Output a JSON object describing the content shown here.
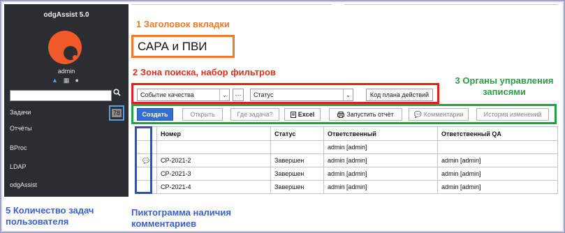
{
  "sidebar": {
    "app_title": "odgAssist 5.0",
    "user": "admin",
    "icons": [
      "warning-icon",
      "grid-icon",
      "user-icon"
    ],
    "search_icon": "🔍",
    "items": [
      {
        "label": "Задачи",
        "badge": "78"
      },
      {
        "label": "Отчёты"
      },
      {
        "label": "BProc"
      },
      {
        "label": "LDAP"
      },
      {
        "label": "odgAssist"
      }
    ]
  },
  "annotations": {
    "a1": "1 Заголовок вкладки",
    "a2": "2 Зона поиска, набор фильтров",
    "a3_line1": "3 Органы управления",
    "a3_line2": "записями",
    "a5_line1": "5 Количество задач",
    "a5_line2": "пользователя",
    "a_icon_line1": "Пиктограмма наличия",
    "a_icon_line2": "комментариев"
  },
  "page_title": "САРА и ПВИ",
  "filters": {
    "type_select": "Событие качества",
    "dots": "···",
    "status_select": "Статус",
    "plan_button": "Код плана действий"
  },
  "toolbar": {
    "create": "Создать",
    "open": "Открыть",
    "where_task": "Где задача?",
    "excel": "Excel",
    "run_report": "Запустить отчёт",
    "comments": "Комментарии",
    "history": "История изменений"
  },
  "table": {
    "headers": [
      "",
      "Номер",
      "Статус",
      "Ответственный",
      "Ответственный QA"
    ],
    "rows": [
      {
        "comment": false,
        "number": "",
        "status": "",
        "responsible": "admin [admin]",
        "qa": ""
      },
      {
        "comment": true,
        "number": "CP-2021-2",
        "status": "Завершен",
        "responsible": "admin [admin]",
        "qa": "admin [admin]"
      },
      {
        "comment": false,
        "number": "CP-2021-3",
        "status": "Завершен",
        "responsible": "admin [admin]",
        "qa": "admin [admin]"
      },
      {
        "comment": false,
        "number": "CP-2021-4",
        "status": "Завершен",
        "responsible": "admin [admin]",
        "qa": "admin [admin]"
      }
    ]
  },
  "colors": {
    "annotation_1": "#f07a2c",
    "annotation_2": "#e0301e",
    "annotation_3": "#2aa043",
    "annotation_blue": "#3a5fd0",
    "sidebar_bg": "#2b2d32",
    "logo": "#f05a28",
    "primary_button": "#2f6fd6"
  }
}
